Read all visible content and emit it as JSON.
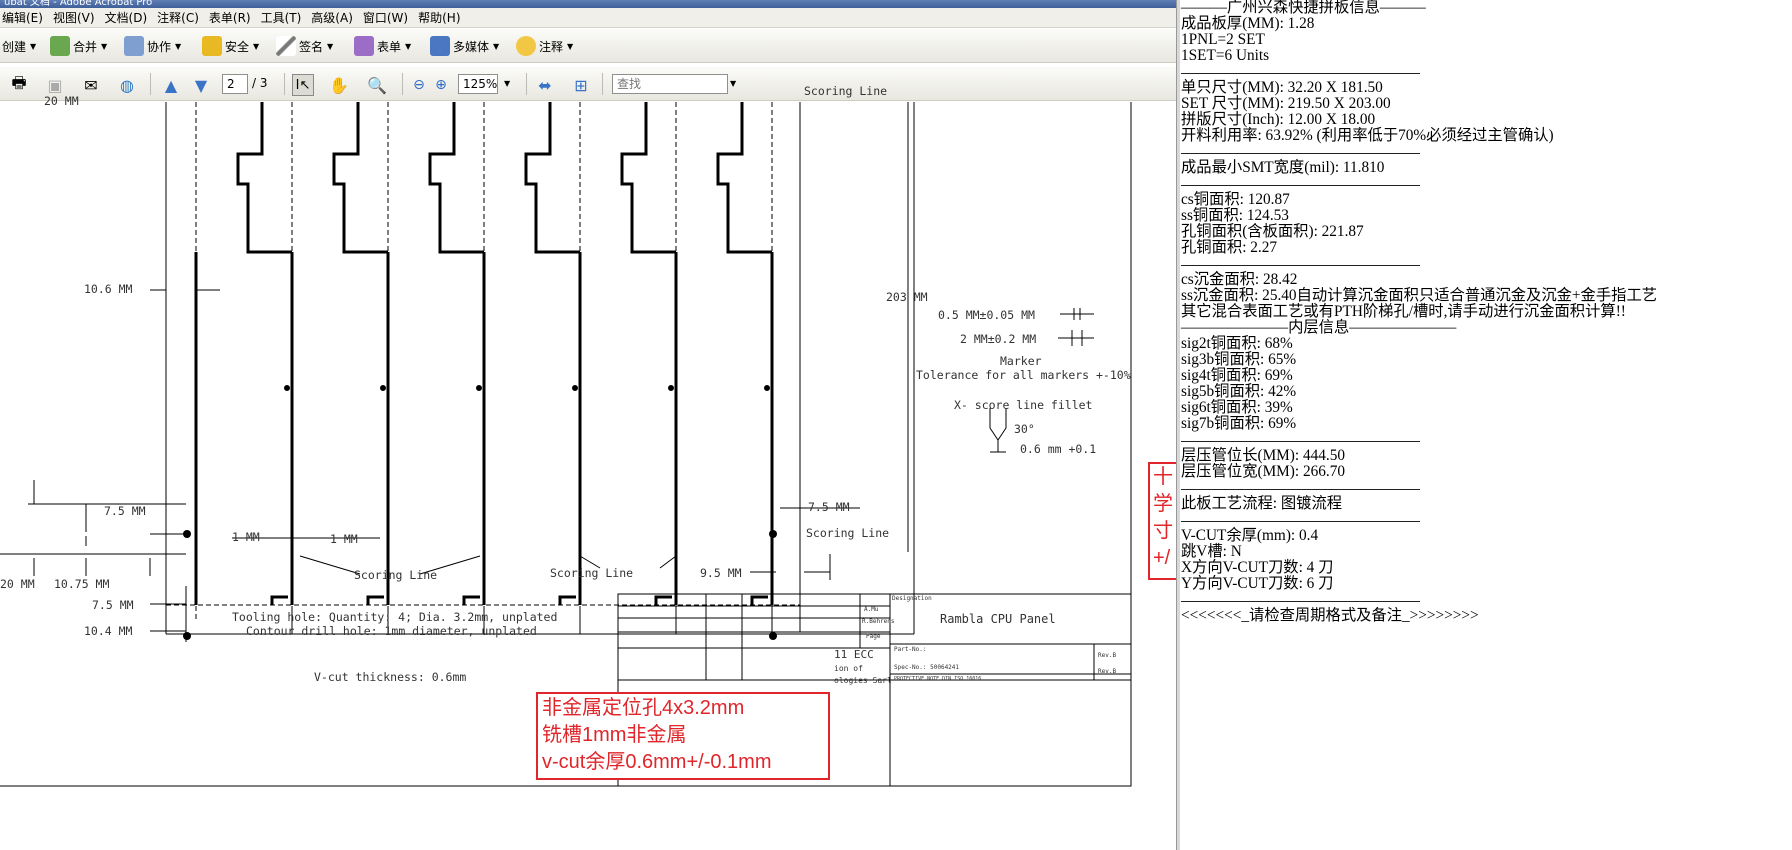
{
  "app": {
    "title": "ubat 文档 - Adobe Acrobat Pro",
    "menu": [
      "编辑(E)",
      "视图(V)",
      "文档(D)",
      "注释(C)",
      "表单(R)",
      "工具(T)",
      "高级(A)",
      "窗口(W)",
      "帮助(H)"
    ],
    "toolbar1": [
      {
        "label": "创建",
        "icon": "create-icon"
      },
      {
        "label": "合并",
        "icon": "combine-icon"
      },
      {
        "label": "协作",
        "icon": "collaborate-icon"
      },
      {
        "label": "安全",
        "icon": "lock-icon"
      },
      {
        "label": "签名",
        "icon": "pen-icon"
      },
      {
        "label": "表单",
        "icon": "form-icon"
      },
      {
        "label": "多媒体",
        "icon": "multimedia-icon"
      },
      {
        "label": "注释",
        "icon": "comment-icon"
      }
    ],
    "toolbar2": {
      "page_current": "2",
      "page_total": "/ 3",
      "zoom": "125%",
      "search_placeholder": "查找"
    }
  },
  "drawing": {
    "dims": {
      "d20_top": "20 MM",
      "d10_6": "10.6 MM",
      "d203": "203 MM",
      "d7_5_left": "7.5 MM",
      "d1_a": "1 MM",
      "d1_b": "1 MM",
      "d20_bottom": "20 MM",
      "d10_75": "10.75 MM",
      "d7_5_low": "7.5 MM",
      "d10_4": "10.4 MM",
      "d7_5_right": "7.5 MM",
      "d9_5": "9.5 MM",
      "scoring_top": "Scoring Line",
      "scoring_right": "Scoring Line",
      "scoring_1": "Scoring Line",
      "scoring_2": "Scoring Line"
    },
    "markers": {
      "tol1": "0.5 MM±0.05 MM",
      "tol2": "2 MM±0.2 MM",
      "marker": "Marker",
      "tolerance": "Tolerance for all markers +-10%",
      "fillet": "X- score line fillet",
      "angle": "30°",
      "depth": "0.6 mm +0.1"
    },
    "notes": {
      "tooling": "Tooling hole: Quantity: 4; Dia. 3.2mm, unplated",
      "contour": "Contour drill hole: 1mm diameter, unplated",
      "vcut": "V-cut thickness: 0.6mm"
    },
    "titleblock": {
      "designation_label": "Designation",
      "designation": "Rambla CPU Panel",
      "ecc": "11 ECC",
      "on_of": "ion of",
      "company": "ologies Sarl",
      "name1": "A.Mu",
      "name2": "R.Behrens",
      "page": "Page",
      "part_no": "Part-No.:",
      "spec_no": "Spec-No.: 50064241",
      "rev1": "Rev.B",
      "rev2": "Rev.B",
      "protective": "PROTECTIVE NOTE DIN ISO 16016"
    },
    "annot_red": [
      "非金属定位孔4x3.2mm",
      "铣槽1mm非金属",
      "v-cut余厚0.6mm+/-0.1mm"
    ],
    "annot_red_side": [
      "十",
      "学",
      "寸",
      "+/"
    ]
  },
  "notepad": [
    "———广州兴森快捷拼板信息———",
    "成品板厚(MM): 1.28",
    "1PNL=2 SET",
    "1SET=6 Units",
    "",
    "单只尺寸(MM): 32.20 X 181.50",
    "SET 尺寸(MM): 219.50 X 203.00",
    "拼版尺寸(Inch): 12.00 X 18.00",
    "开料利用率: 63.92% (利用率低于70%必须经过主管确认)",
    "",
    "成品最小SMT宽度(mil): 11.810",
    "",
    "cs铜面积: 120.87",
    "ss铜面积: 124.53",
    "孔铜面积(含板面积): 221.87",
    "孔铜面积: 2.27",
    "",
    "cs沉金面积: 28.42",
    "ss沉金面积: 25.40自动计算沉金面积只适合普通沉金及沉金+金手指工艺",
    "其它混合表面工艺或有PTH阶梯孔/槽时,请手动进行沉金面积计算!!",
    "———————内层信息———————",
    "sig2t铜面积: 68%",
    "sig3b铜面积: 65%",
    "sig4t铜面积: 69%",
    "sig5b铜面积: 42%",
    "sig6t铜面积: 39%",
    "sig7b铜面积: 69%",
    "",
    "层压管位长(MM): 444.50",
    "层压管位宽(MM): 266.70",
    "",
    "此板工艺流程: 图镀流程",
    "",
    "V-CUT余厚(mm): 0.4",
    "跳V槽: N",
    "X方向V-CUT刀数: 4 刀",
    "Y方向V-CUT刀数: 6 刀",
    "",
    "<<<<<<<_请检查周期格式及备注_>>>>>>>>"
  ]
}
